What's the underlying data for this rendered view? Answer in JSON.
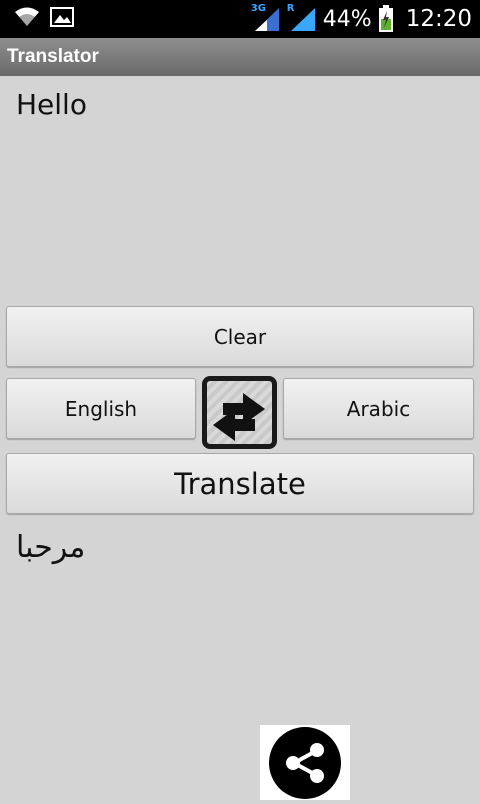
{
  "status_bar": {
    "network_3g": "3G",
    "network_r": "R",
    "battery": "44%",
    "time": "12:20",
    "icons": [
      "wifi-icon",
      "picture-icon",
      "signal-icon",
      "battery-icon"
    ]
  },
  "app": {
    "title": "Translator"
  },
  "input": {
    "text": "Hello"
  },
  "buttons": {
    "clear": "Clear",
    "source_language": "English",
    "target_language": "Arabic",
    "translate": "Translate",
    "swap_icon": "swap-arrows-icon",
    "share_icon": "share-icon"
  },
  "output": {
    "text": "مرحبا"
  },
  "colors": {
    "background": "#d4d4d4",
    "status_bar": "#000000",
    "title_bar": "#7c7c7c",
    "network_accent": "#3aa6ff"
  }
}
